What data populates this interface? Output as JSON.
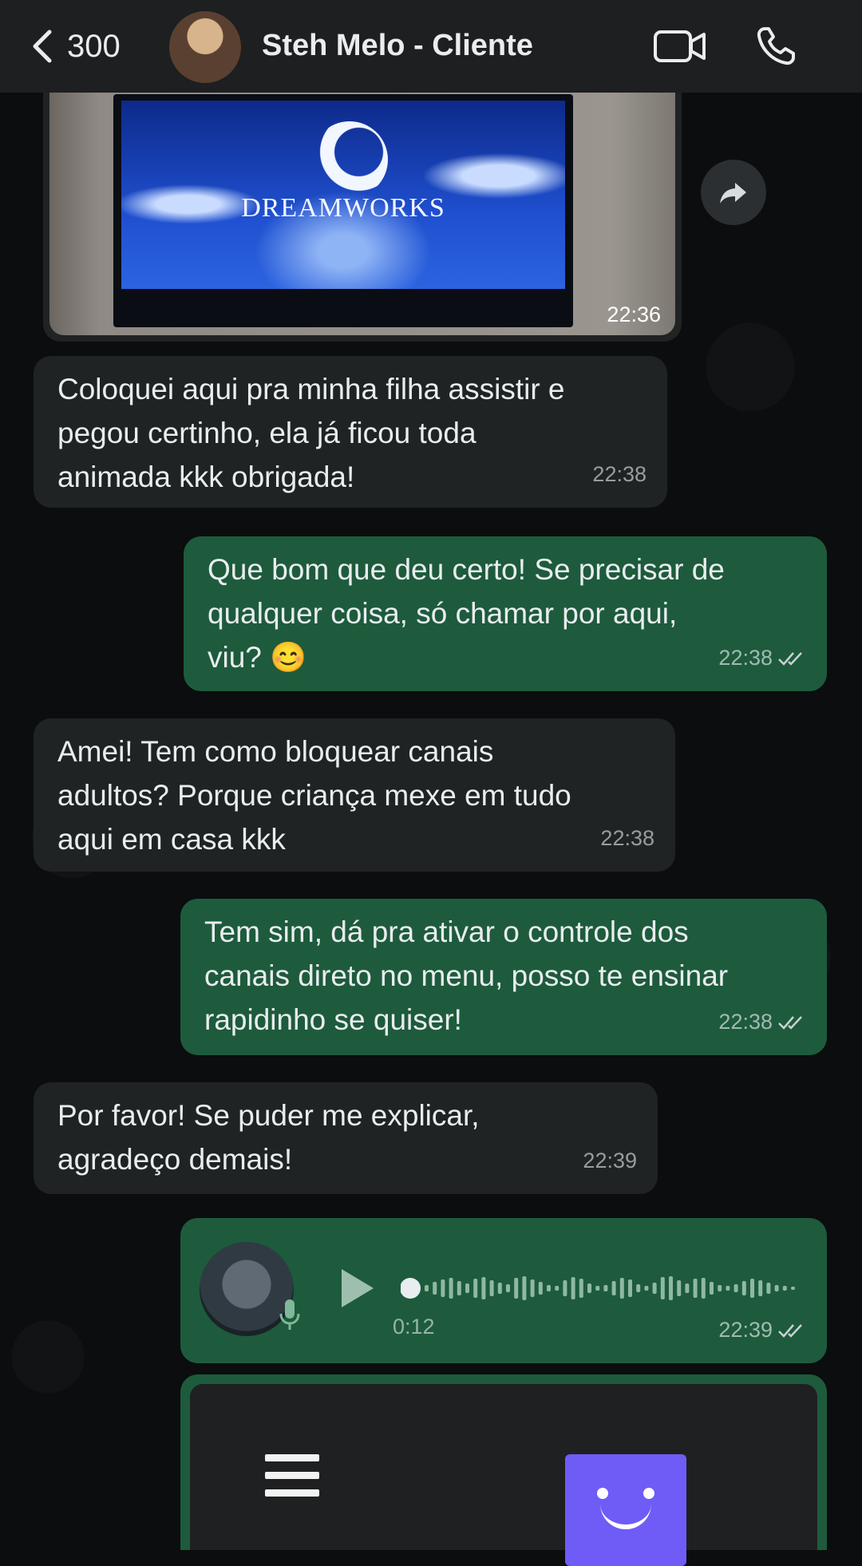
{
  "header": {
    "back_count": "300",
    "contact_name": "Steh Melo - Cliente"
  },
  "image_message": {
    "logo_text": "DREAMWORKS",
    "time": "22:36"
  },
  "messages": [
    {
      "direction": "in",
      "text": "Coloquei aqui pra minha filha assistir e\npegou certinho, ela já ficou toda\nanimada kkk obrigada!",
      "time": "22:38"
    },
    {
      "direction": "out",
      "text": "Que bom que deu certo! Se precisar de\nqualquer coisa, só chamar por aqui,\nviu? 😊",
      "time": "22:38",
      "status": "read"
    },
    {
      "direction": "in",
      "text": "Amei! Tem como bloquear canais\nadultos? Porque criança mexe em tudo\naqui em casa kkk",
      "time": "22:38"
    },
    {
      "direction": "out",
      "text": "Tem sim, dá pra ativar o controle dos\ncanais direto no menu, posso te ensinar\nrapidinho se quiser!",
      "time": "22:38",
      "status": "read"
    },
    {
      "direction": "in",
      "text": "Por favor! Se puder me explicar,\nagradeço demais!",
      "time": "22:39"
    }
  ],
  "audio_message": {
    "duration": "0:12",
    "time": "22:39",
    "status": "read",
    "played_fraction": 0.0
  },
  "colors": {
    "incoming_bubble": "#202324",
    "outgoing_bubble": "#1d5b3c",
    "header": "#1d1f20",
    "background": "#0b0d0e"
  },
  "icons": [
    "chevron-left-icon",
    "video-call-icon",
    "phone-icon",
    "forward-icon",
    "play-icon",
    "microphone-icon",
    "double-check-icon",
    "menu-icon"
  ]
}
